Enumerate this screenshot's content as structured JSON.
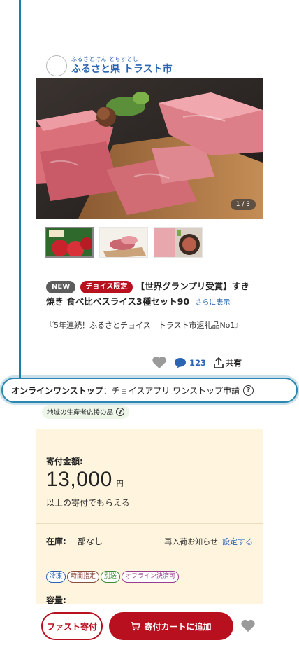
{
  "municipality": {
    "ruby": "ふるさとけん とらすとし",
    "name": "ふるさと県 トラスト市"
  },
  "gallery": {
    "counter": "1 / 3",
    "thumbnails": [
      "apple-box",
      "steak-board",
      "sukiyaki-set"
    ]
  },
  "product": {
    "badges": {
      "new": "NEW",
      "choice": "チョイス限定"
    },
    "title": "【世界グランプリ受賞】すき焼き 食べ比べスライス3種セット90",
    "more": "さらに表示",
    "description": "『5年連続！ふるさとチョイス　トラスト市返礼品No1』"
  },
  "actions": {
    "comment_count": "123",
    "share_label": "共有"
  },
  "onestop": {
    "label": "オンラインワンストップ",
    "value": "：チョイスアプリ ワンストップ申請",
    "help": "?"
  },
  "local_tag": {
    "label": "地域の生産者応援の品",
    "help": "?"
  },
  "donation": {
    "label": "寄付金額:",
    "amount": "13,000",
    "unit": "円",
    "note": "以上の寄付でもらえる"
  },
  "stock": {
    "label": "在庫:",
    "value": "一部なし",
    "restock_label": "再入荷お知らせ",
    "restock_link": "設定する"
  },
  "tags": [
    {
      "label": "冷凍",
      "color": "#2a64b3"
    },
    {
      "label": "時間指定",
      "color": "#8a4b3c"
    },
    {
      "label": "別送",
      "color": "#3f8a3a"
    },
    {
      "label": "オフライン決済可",
      "color": "#9a3d8f"
    }
  ],
  "capacity_label": "容量:",
  "bottom": {
    "fast_label": "ファスト寄付",
    "cart_label": "寄付カートに追加"
  },
  "colors": {
    "brand_red": "#b8101f",
    "link_blue": "#2a64b3",
    "highlight_border": "#2b87b0",
    "price_box_bg": "#fff5df"
  }
}
